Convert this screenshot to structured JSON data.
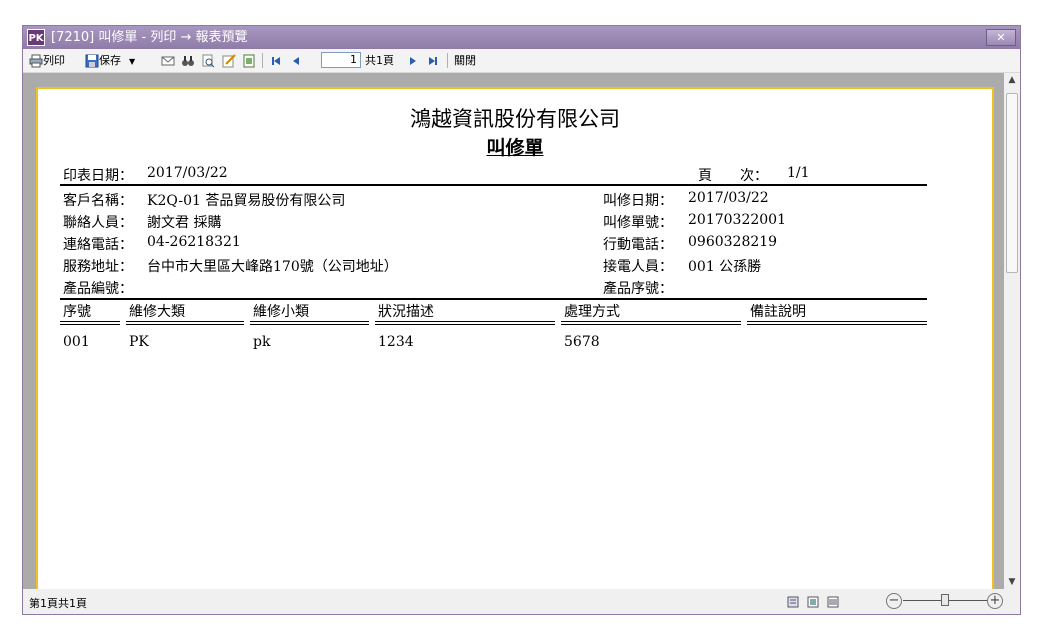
{
  "window": {
    "title": "[7210] 叫修單 - 列印 → 報表預覽",
    "app_icon": "PK"
  },
  "toolbar": {
    "print_label": "列印",
    "save_label": "保存",
    "page_value": "1",
    "page_total": "共1頁",
    "close_label": "關閉"
  },
  "report": {
    "company": "鴻越資訊股份有限公司",
    "title": "叫修單",
    "print_date_label": "印表日期：",
    "print_date": "2017/03/22",
    "page_label": "頁　　次：",
    "page_value": "1/1",
    "customer_label": "客戶名稱：",
    "customer": "K2Q-01 荅品貿易股份有限公司",
    "contact_label": "聯絡人員：",
    "contact": "謝文君 採購",
    "phone_label": "連絡電話：",
    "phone": "04-26218321",
    "address_label": "服務地址：",
    "address": "台中市大里區大峰路170號（公司地址）",
    "product_no_label": "產品編號：",
    "repair_date_label": "叫修日期：",
    "repair_date": "2017/03/22",
    "repair_no_label": "叫修單號：",
    "repair_no": "20170322001",
    "mobile_label": "行動電話：",
    "mobile": "0960328219",
    "receiver_label": "接電人員：",
    "receiver": "001 公孫勝",
    "product_serial_label": "產品序號：",
    "columns": [
      "序號",
      "維修大類",
      "維修小類",
      "狀況描述",
      "處理方式",
      "備註說明"
    ],
    "rows": [
      [
        "001",
        "PK",
        "pk",
        "1234",
        "5678",
        ""
      ]
    ]
  },
  "status": {
    "text": "第1頁共1頁"
  }
}
